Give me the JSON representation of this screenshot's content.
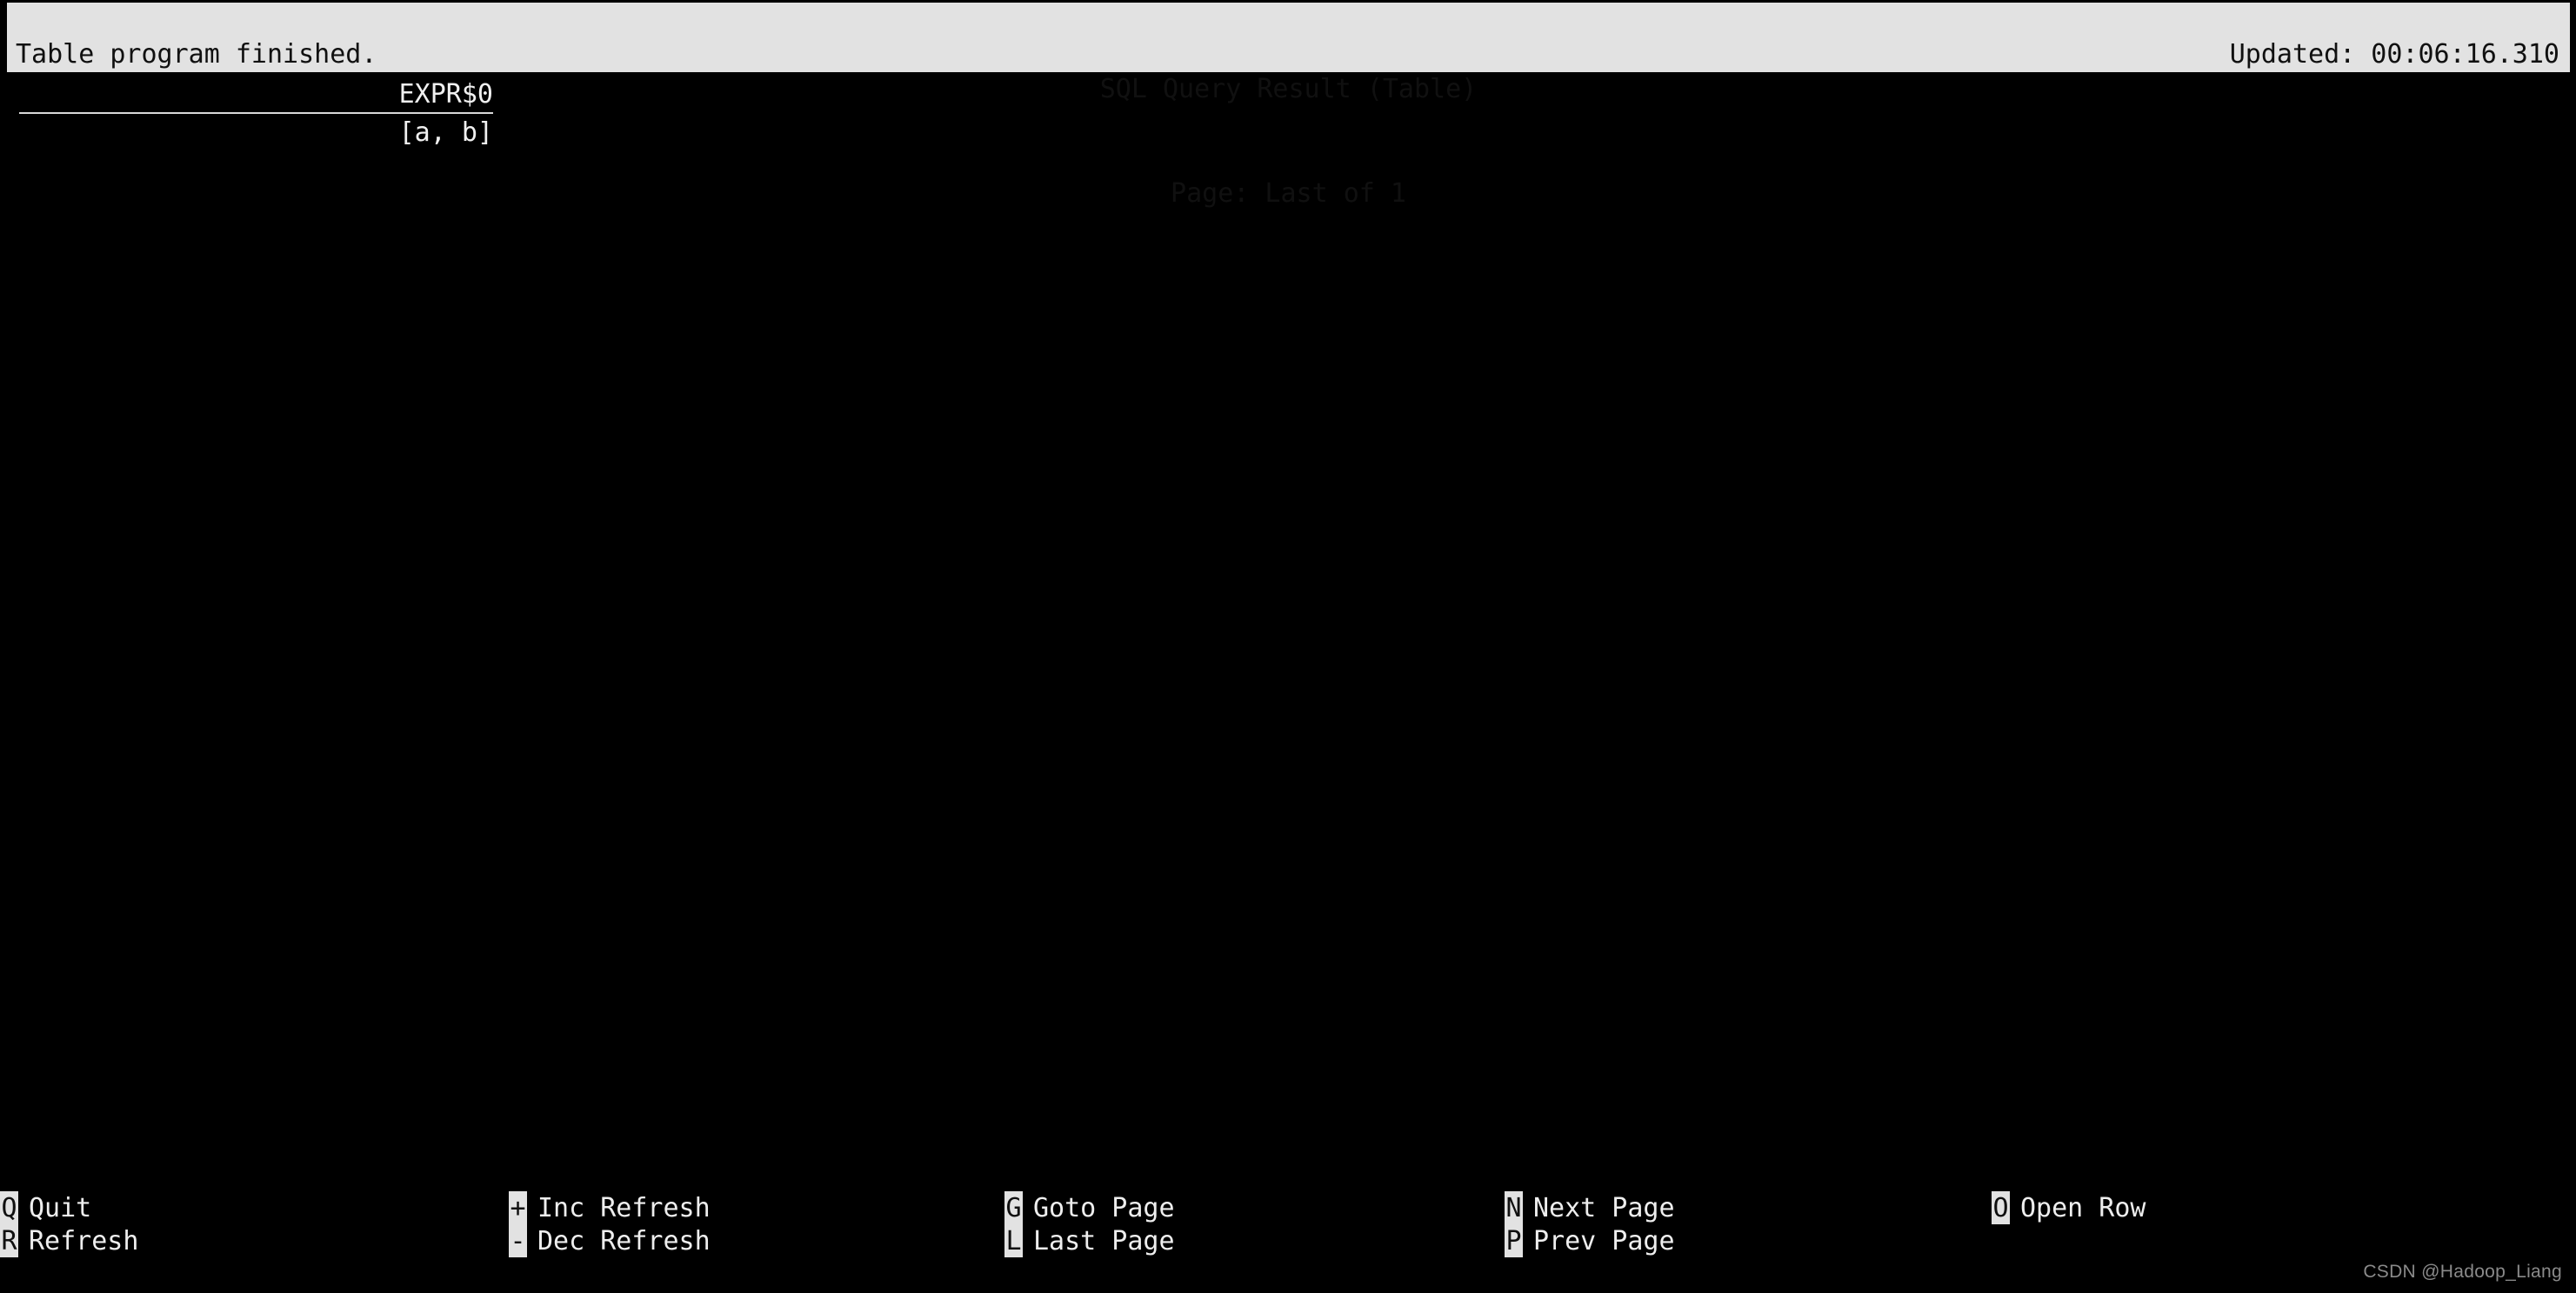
{
  "app": {
    "title": "SQL Query Result (Table)",
    "background_color": "#000000",
    "bar_color": "#e2e2e2",
    "bar_text_color": "#101010",
    "text_color": "#eeeeee"
  },
  "header": {
    "status_message": "Table program finished.",
    "title": "SQL Query Result (Table)",
    "page_indicator": "Page: Last of 1",
    "updated": "Updated: 00:06:16.310"
  },
  "table": {
    "columns": [
      "EXPR$0"
    ],
    "rows": [
      [
        "[a, b]"
      ]
    ]
  },
  "footer": {
    "groups": [
      {
        "commands": [
          {
            "key": "Q",
            "label": "Quit"
          },
          {
            "key": "R",
            "label": "Refresh"
          }
        ]
      },
      {
        "commands": [
          {
            "key": "+",
            "label": "Inc Refresh"
          },
          {
            "key": "-",
            "label": "Dec Refresh"
          }
        ]
      },
      {
        "commands": [
          {
            "key": "G",
            "label": "Goto Page"
          },
          {
            "key": "L",
            "label": "Last Page"
          }
        ]
      },
      {
        "commands": [
          {
            "key": "N",
            "label": "Next Page"
          },
          {
            "key": "P",
            "label": "Prev Page"
          }
        ]
      },
      {
        "commands": [
          {
            "key": "O",
            "label": "Open Row"
          }
        ]
      }
    ]
  },
  "watermark": {
    "text": "CSDN @Hadoop_Liang"
  }
}
